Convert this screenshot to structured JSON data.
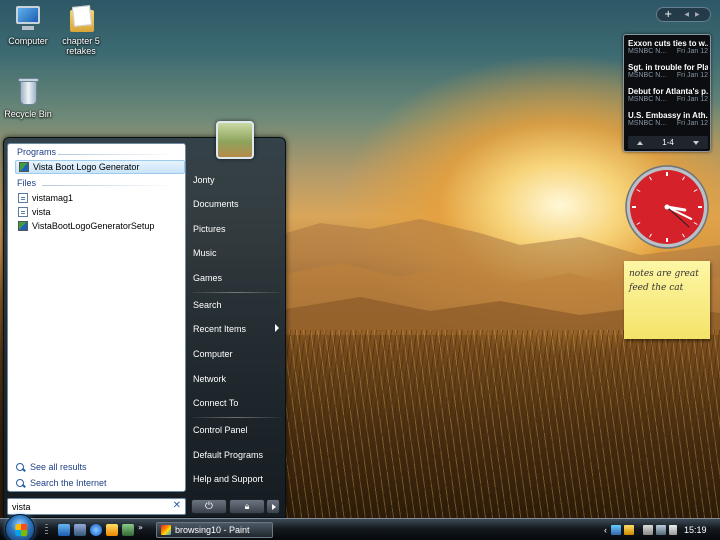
{
  "desktop": {
    "icons": [
      {
        "label": "Computer"
      },
      {
        "label": "chapter 5 retakes"
      },
      {
        "label": "Recycle Bin"
      }
    ]
  },
  "start_menu": {
    "programs_header": "Programs",
    "files_header": "Files",
    "programs": [
      {
        "label": "Vista Boot Logo Generator",
        "icon": "app-icon"
      }
    ],
    "files": [
      {
        "label": "vistamag1",
        "icon": "document-icon"
      },
      {
        "label": "vista",
        "icon": "document-icon"
      },
      {
        "label": "VistaBootLogoGeneratorSetup",
        "icon": "app-icon"
      }
    ],
    "see_all_results": "See all results",
    "search_internet": "Search the Internet",
    "search_value": "vista",
    "right_items": [
      {
        "label": "Jonty"
      },
      {
        "label": "Documents"
      },
      {
        "label": "Pictures"
      },
      {
        "label": "Music"
      },
      {
        "label": "Games"
      },
      {
        "label": "Search"
      },
      {
        "label": "Recent Items"
      },
      {
        "label": "Computer"
      },
      {
        "label": "Network"
      },
      {
        "label": "Connect To"
      },
      {
        "label": "Control Panel"
      },
      {
        "label": "Default Programs"
      },
      {
        "label": "Help and Support"
      }
    ]
  },
  "sidebar": {
    "add_symbol": "+",
    "news": [
      {
        "title": "Exxon cuts ties to w...",
        "source": "MSNBC N...",
        "date": "Fri Jan 12"
      },
      {
        "title": "Sgt. in trouble for Pla...",
        "source": "MSNBC N...",
        "date": "Fri Jan 12"
      },
      {
        "title": "Debut for Atlanta's p...",
        "source": "MSNBC N...",
        "date": "Fri Jan 12"
      },
      {
        "title": "U.S. Embassy in Ath...",
        "source": "MSNBC N...",
        "date": "Fri Jan 12"
      }
    ],
    "news_page": "1-4",
    "clock": {
      "hour": 3,
      "minute": 19,
      "second": 22
    },
    "note_lines": [
      "notes are great",
      "feed the cat"
    ]
  },
  "taskbar": {
    "task": "browsing10 - Paint",
    "time": "15:19"
  },
  "colors": {
    "link_blue": "#1e3f87",
    "clock_red": "#d4212a",
    "note_yellow": "#fdf6a6"
  }
}
